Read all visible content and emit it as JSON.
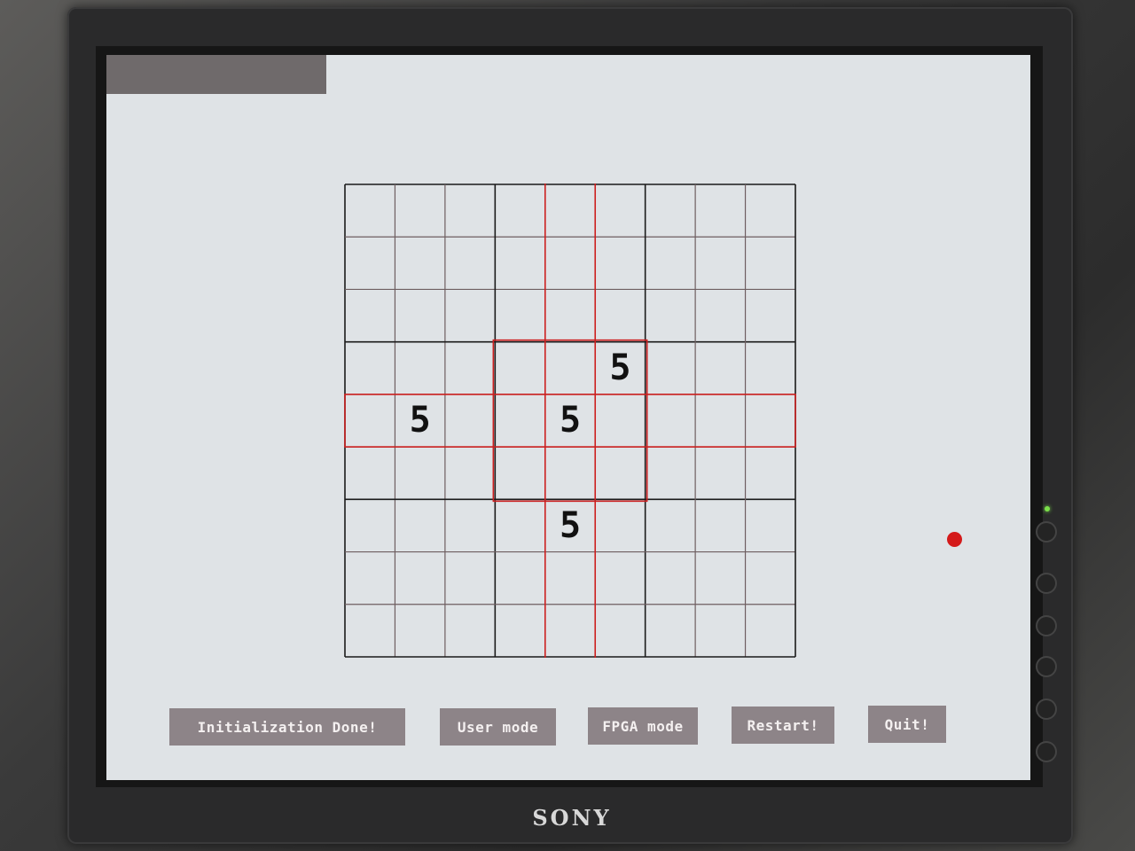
{
  "board": {
    "size": 9,
    "given_digits": [
      {
        "row": 3,
        "col": 5,
        "value": "5"
      },
      {
        "row": 4,
        "col": 1,
        "value": "5"
      },
      {
        "row": 4,
        "col": 4,
        "value": "5"
      },
      {
        "row": 6,
        "col": 4,
        "value": "5"
      }
    ],
    "highlight": {
      "row": 4,
      "col": 4,
      "color": "#cc1f1f"
    }
  },
  "buttons": {
    "init": "Initialization Done!",
    "user_mode": "User mode",
    "fpga_mode": "FPGA mode",
    "restart": "Restart!",
    "quit": "Quit!"
  },
  "monitor": {
    "brand": "SONY",
    "indicator_color": "#d41a1a"
  }
}
